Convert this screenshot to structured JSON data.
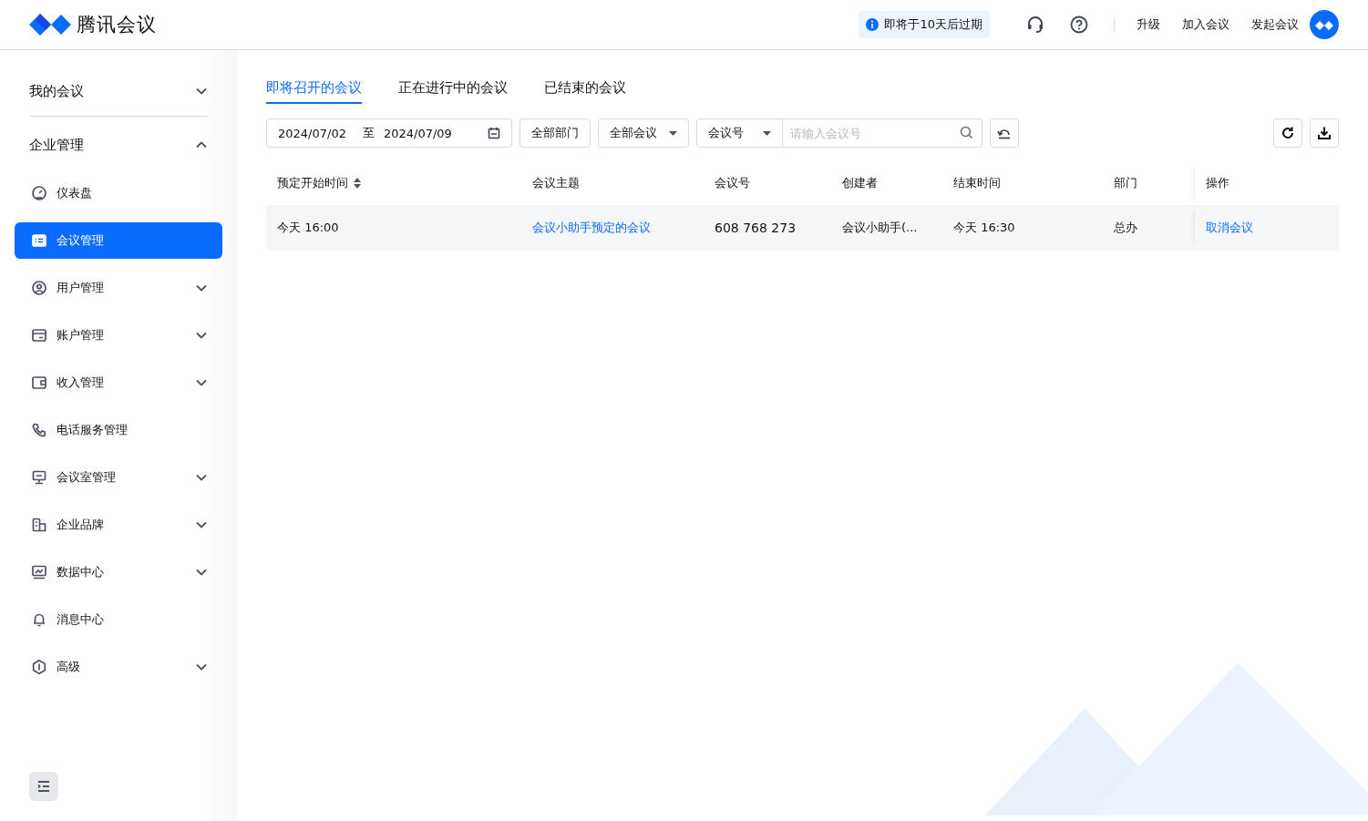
{
  "header": {
    "brand": "腾讯会议",
    "notice": "即将于10天后过期",
    "links": [
      "升级",
      "加入会议",
      "发起会议"
    ]
  },
  "sidebar": {
    "groups": [
      {
        "label": "我的会议",
        "expanded": false
      },
      {
        "label": "企业管理",
        "expanded": true,
        "children": [
          {
            "label": "仪表盘",
            "kind": "link",
            "selected": false
          },
          {
            "label": "会议管理",
            "kind": "link",
            "selected": true
          },
          {
            "label": "用户管理",
            "kind": "submenu",
            "selected": false
          },
          {
            "label": "账户管理",
            "kind": "submenu",
            "selected": false
          },
          {
            "label": "收入管理",
            "kind": "submenu",
            "selected": false
          },
          {
            "label": "电话服务管理",
            "kind": "link",
            "selected": false
          },
          {
            "label": "会议室管理",
            "kind": "submenu",
            "selected": false
          },
          {
            "label": "企业品牌",
            "kind": "submenu",
            "selected": false
          },
          {
            "label": "数据中心",
            "kind": "submenu",
            "selected": false
          },
          {
            "label": "消息中心",
            "kind": "link",
            "selected": false
          },
          {
            "label": "高级",
            "kind": "submenu",
            "selected": false
          }
        ]
      }
    ]
  },
  "tabs": [
    {
      "label": "即将召开的会议",
      "selected": true
    },
    {
      "label": "正在进行中的会议",
      "selected": false
    },
    {
      "label": "已结束的会议",
      "selected": false
    }
  ],
  "filters": {
    "date_start": "2024/07/02",
    "date_separator": "至",
    "date_end": "2024/07/09",
    "department": "全部部门",
    "meeting_type": "全部会议",
    "search_by": "会议号",
    "search": {
      "placeholder": "请输入会议号"
    }
  },
  "table": {
    "columns": [
      {
        "label": "预定开始时间",
        "sortable": true
      },
      {
        "label": "会议主题",
        "sortable": false
      },
      {
        "label": "会议号",
        "sortable": false
      },
      {
        "label": "创建者",
        "sortable": false
      },
      {
        "label": "结束时间",
        "sortable": false
      },
      {
        "label": "部门",
        "sortable": false
      },
      {
        "label": "操作",
        "sortable": false
      }
    ],
    "rows": [
      {
        "start": "今天  16:00",
        "topic": "会议小助手预定的会议",
        "meeting_id": "608 768 273",
        "creator": "会议小助手(...",
        "end": "今天  16:30",
        "department": "总办",
        "action": "取消会议"
      }
    ]
  }
}
